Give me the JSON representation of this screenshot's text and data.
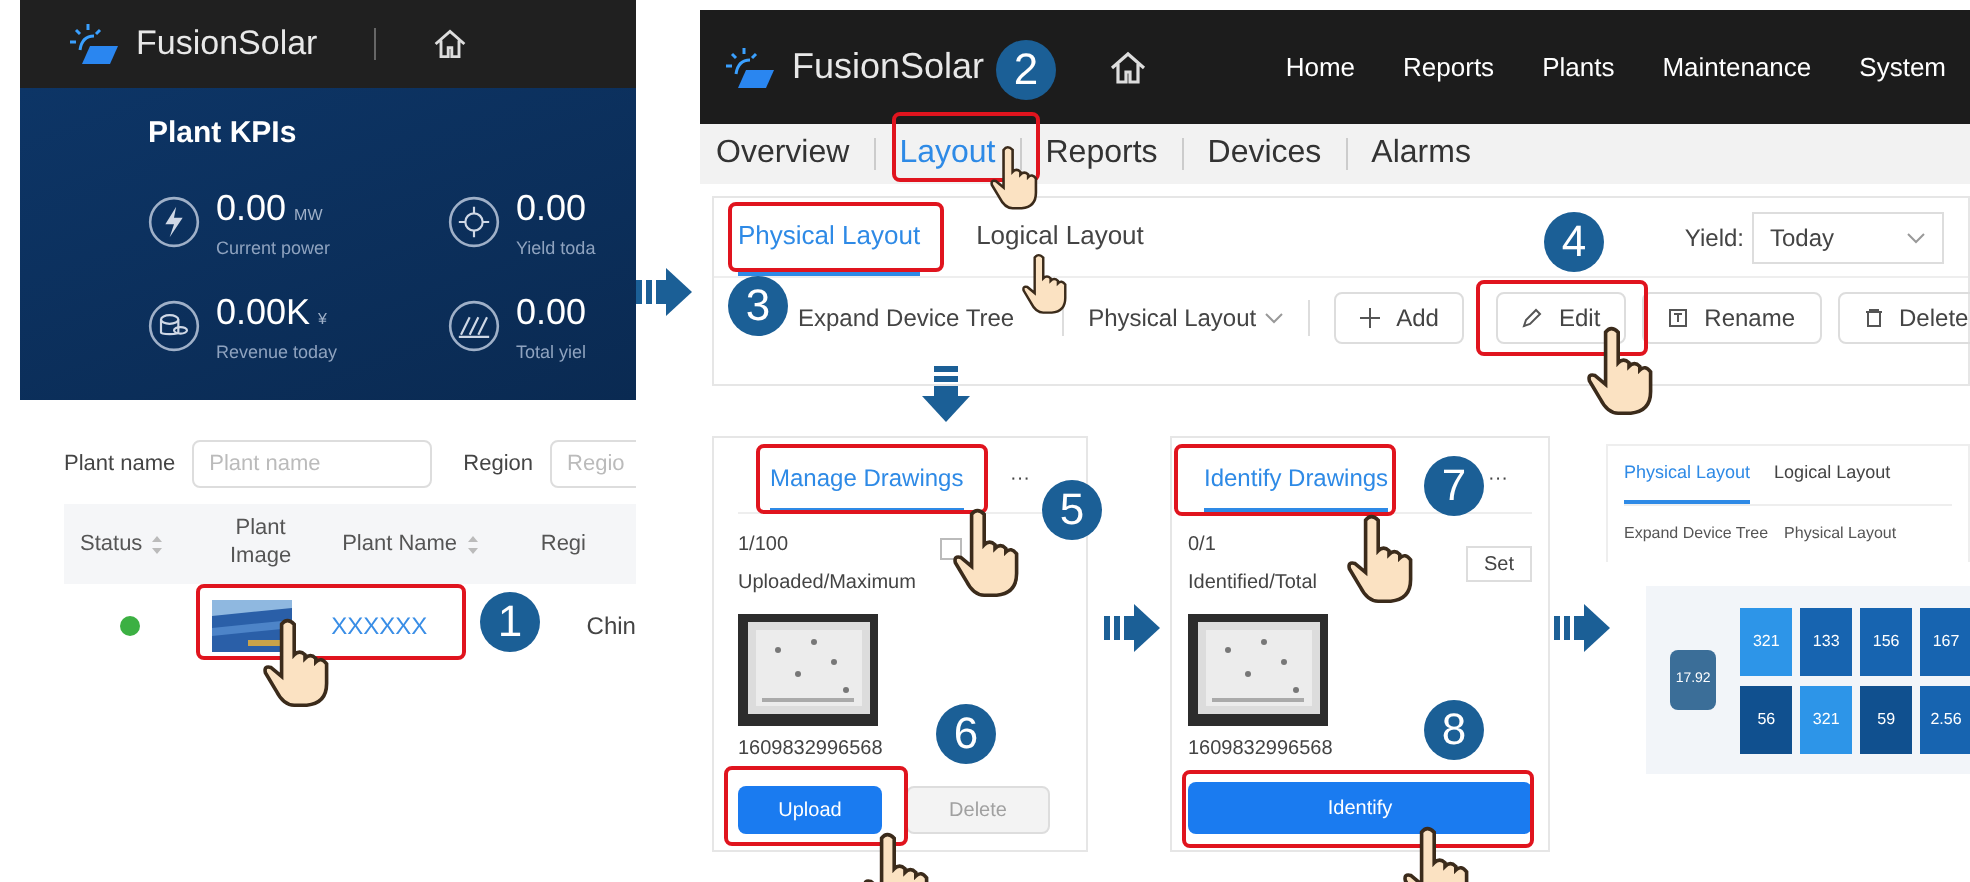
{
  "plant_list": {
    "app_name": "FusionSolar",
    "kpi_title": "Plant KPIs",
    "kpis": [
      {
        "value": "0.00",
        "unit": "MW",
        "label": "Current power",
        "kind": "power"
      },
      {
        "value": "0.00",
        "label": "Yield toda",
        "kind": "yield"
      },
      {
        "value": "0.00K",
        "unit": "¥",
        "label": "Revenue today",
        "kind": "revenue"
      },
      {
        "value": "0.00",
        "label": "Total yiel",
        "kind": "total"
      }
    ],
    "filters": [
      {
        "label": "Plant name",
        "placeholder": "Plant name"
      },
      {
        "label": "Region",
        "placeholder": "Regio"
      }
    ],
    "columns": [
      {
        "label": "Status",
        "sortable": true
      },
      {
        "label": "Plant Image",
        "sortable": false
      },
      {
        "label": "Plant Name",
        "sortable": true
      },
      {
        "label": "Regi",
        "sortable": false
      }
    ],
    "rows": [
      {
        "color": "#3cb043",
        "plant_name": "XXXXXX",
        "region": "Chin"
      }
    ]
  },
  "plant_layout": {
    "app_name": "FusionSolar",
    "menu": [
      "Home",
      "Reports",
      "Plants",
      "Maintenance",
      "System"
    ],
    "tabs": [
      {
        "label": "Overview",
        "selected": false
      },
      {
        "label": "Layout",
        "selected": true
      },
      {
        "label": "Reports",
        "selected": false
      },
      {
        "label": "Devices",
        "selected": false
      },
      {
        "label": "Alarms",
        "selected": false
      }
    ],
    "layout_tabs": [
      {
        "label": "Physical Layout",
        "selected": true
      },
      {
        "label": "Logical Layout",
        "selected": false
      }
    ],
    "yield_label": "Yield:",
    "yield_value": "Today",
    "toolbar": [
      {
        "label": "Expand Device Tree",
        "kind": "toggle"
      },
      {
        "label": "Physical Layout",
        "kind": "dropdown"
      },
      {
        "label": "Add",
        "kind": "add"
      },
      {
        "label": "Edit",
        "kind": "edit"
      },
      {
        "label": "Rename",
        "kind": "rename"
      },
      {
        "label": "Delete",
        "kind": "delete"
      }
    ]
  },
  "manage_drawings": {
    "tab": "Manage Drawings",
    "more": "···",
    "count": "1/100",
    "count_label": "Uploaded/Maximum",
    "checked": false,
    "file_name": "1609832996568",
    "buttons": [
      {
        "label": "Upload",
        "kind": "primary",
        "disabled": false
      },
      {
        "label": "Delete",
        "kind": "secondary",
        "disabled": true
      }
    ]
  },
  "identify_drawings": {
    "tab": "Identify Drawings",
    "more": "···",
    "count": "0/1",
    "count_label": "Identified/Total",
    "set_button": "Set",
    "file_name": "1609832996568",
    "button": "Identify"
  },
  "layout_preview": {
    "tabs": [
      {
        "label": "Physical Layout",
        "selected": true
      },
      {
        "label": "Logical Layout",
        "selected": false
      }
    ],
    "toolbar": [
      "Expand Device Tree",
      "Physical Layout"
    ],
    "inverter_value": "17.92",
    "modules": [
      {
        "value": "321",
        "color": "#2d95e8"
      },
      {
        "value": "133",
        "color": "#1764b0"
      },
      {
        "value": "156",
        "color": "#1764b0"
      },
      {
        "value": "167",
        "color": "#1764b0"
      },
      {
        "value": "56",
        "color": "#10508f"
      },
      {
        "value": "321",
        "color": "#2d95e8"
      },
      {
        "value": "59",
        "color": "#10508f"
      },
      {
        "value": "2.56",
        "color": "#1764b0"
      }
    ]
  },
  "steps": [
    "1",
    "2",
    "3",
    "4",
    "5",
    "6",
    "7",
    "8"
  ]
}
